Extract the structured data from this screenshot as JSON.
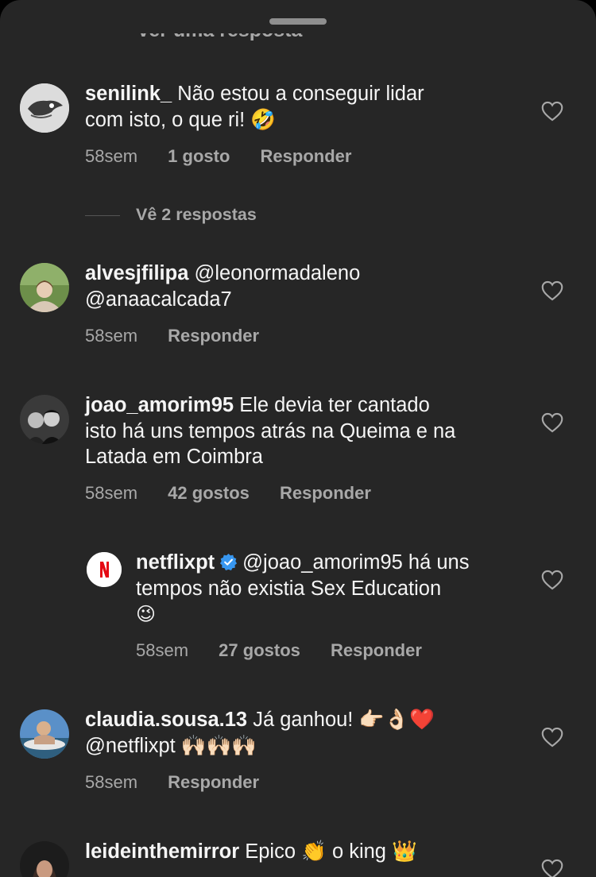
{
  "partial_link": "Ver uma resposta",
  "comments": [
    {
      "username": "senilink_",
      "text_lines": [
        "Não estou a conseguir lidar",
        "com isto, o que ri! 🤣"
      ],
      "time": "58sem",
      "likes": "1 gosto",
      "reply": "Responder"
    },
    {
      "username": "alvesjfilipa",
      "text_lines": [
        "@leonormadaleno",
        "@anaacalcada7"
      ],
      "time": "58sem",
      "reply": "Responder"
    },
    {
      "username": "joao_amorim95",
      "text_lines": [
        "Ele devia ter cantado",
        "isto há uns tempos atrás na Queima e na",
        "Latada em Coimbra"
      ],
      "time": "58sem",
      "likes": "42 gostos",
      "reply": "Responder"
    },
    {
      "username": "netflixpt",
      "verified": true,
      "text_lines": [
        "@joao_amorim95 há uns",
        "tempos não existia Sex Education",
        "😉"
      ],
      "time": "58sem",
      "likes": "27 gostos",
      "reply": "Responder"
    },
    {
      "username": "claudia.sousa.13",
      "text_lines": [
        "Já ganhou! 👉🏻👌🏻❤️",
        "@netflixpt 🙌🏻🙌🏻🙌🏻"
      ],
      "time": "58sem",
      "reply": "Responder"
    },
    {
      "username": "leideinthemirror",
      "text_lines": [
        "Epico 👏 o king 👑"
      ]
    }
  ],
  "view_replies": "Vê 2 respostas",
  "icons": {
    "like": "heart-outline-icon",
    "verified": "verified-badge-icon",
    "netflix": "netflix-logo-icon"
  },
  "colors": {
    "background": "#262626",
    "secondary_text": "#a8a8a8",
    "verified_blue": "#3897f0",
    "netflix_red": "#e50914"
  }
}
